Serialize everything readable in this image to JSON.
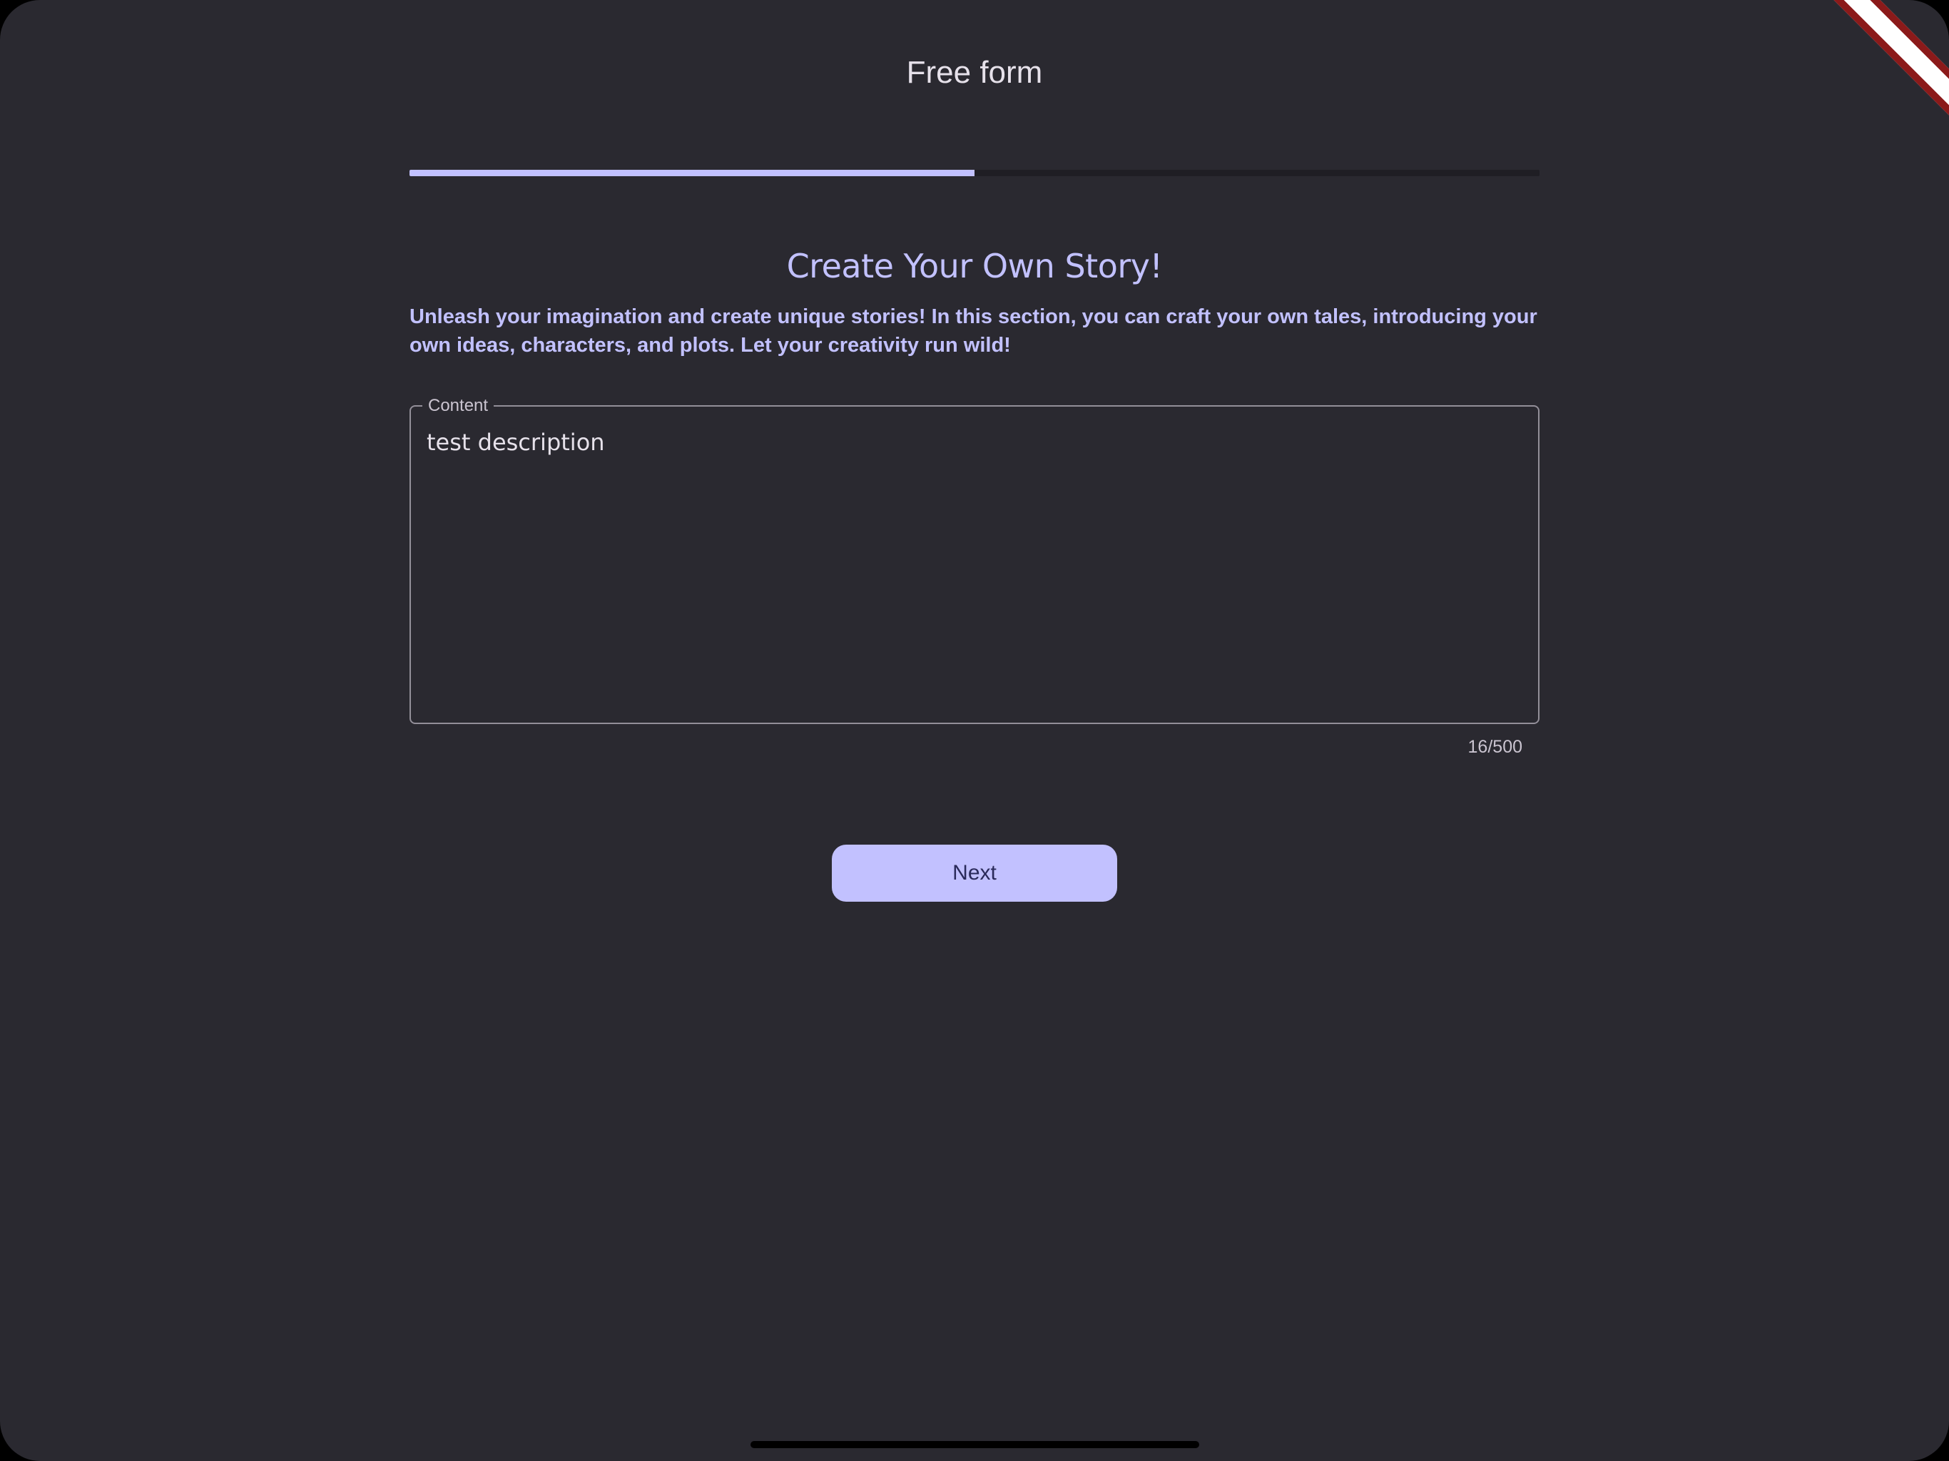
{
  "app_bar": {
    "title": "Free form"
  },
  "progress": {
    "fraction": 0.5,
    "color": "#c2c1ff"
  },
  "story": {
    "heading": "Create Your Own Story!",
    "description": "Unleash your imagination and create unique stories! In this section, you can craft your own tales, introducing your own ideas, characters, and plots. Let your creativity run wild!"
  },
  "content_field": {
    "label": "Content",
    "value": "test description",
    "counter": "16/500"
  },
  "actions": {
    "next_label": "Next"
  },
  "colors": {
    "background": "#2a2930",
    "accent": "#c2c1ff",
    "on_surface": "#e6e1ea",
    "outline": "#938f99"
  }
}
